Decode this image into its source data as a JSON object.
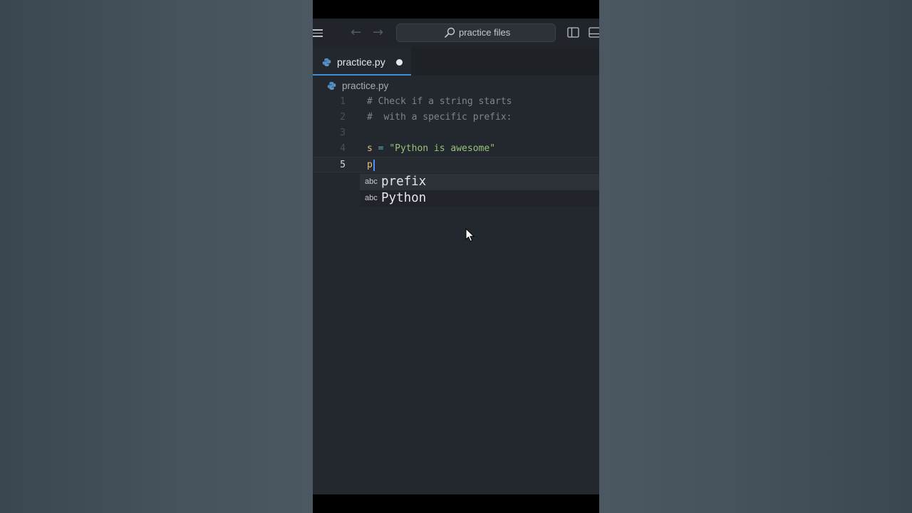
{
  "titlebar": {
    "search_placeholder": "practice files"
  },
  "tabs": [
    {
      "label": "practice.py",
      "dirty": true
    }
  ],
  "breadcrumb": {
    "file": "practice.py"
  },
  "editor": {
    "line_numbers": [
      "1",
      "2",
      "3",
      "4",
      "5"
    ],
    "lines": {
      "l1": "# Check if a string starts",
      "l2": "#  with a specific prefix:",
      "l3": "",
      "l4_var": "s",
      "l4_op": " = ",
      "l4_str": "\"Python is awesome\"",
      "l5": "p"
    },
    "active_line": "5"
  },
  "suggestions": [
    {
      "kind": "abc",
      "label": "prefix"
    },
    {
      "kind": "abc",
      "label": "Python"
    }
  ],
  "colors": {
    "accent": "#3d8fd8",
    "editor_bg": "#23272e",
    "comment": "#7f848e",
    "string": "#98c379"
  },
  "icons": [
    "menu-icon",
    "back-arrow-icon",
    "forward-arrow-icon",
    "search-icon",
    "toggle-sidebar-icon",
    "toggle-panel-icon",
    "python-file-icon",
    "mouse-pointer-icon"
  ]
}
